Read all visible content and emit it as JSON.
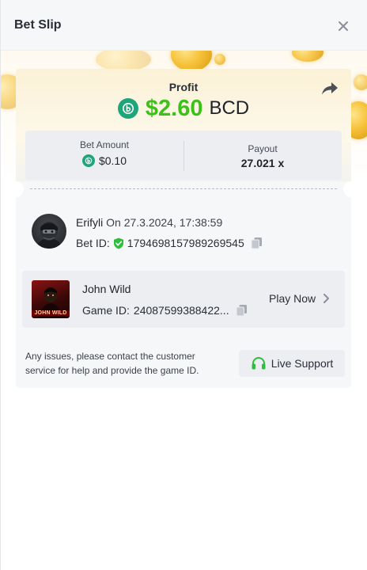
{
  "header": {
    "title": "Bet Slip"
  },
  "profit": {
    "label": "Profit",
    "amount": "$2.60",
    "currency": "BCD"
  },
  "stats": {
    "bet_amount_label": "Bet Amount",
    "bet_amount_value": "$0.10",
    "payout_label": "Payout",
    "payout_value": "27.021 x"
  },
  "user": {
    "name": "Erifyli",
    "played_on": "On 27.3.2024, 17:38:59",
    "bet_id_label": "Bet ID:",
    "bet_id": "1794698157989269545"
  },
  "game": {
    "name": "John Wild",
    "thumb_text": "JOHN WILD",
    "game_id_label": "Game ID:",
    "game_id": "24087599388422...",
    "play_label": "Play Now"
  },
  "footer": {
    "help_text": "Any issues, please contact the customer service for help and provide the game ID.",
    "support_label": "Live Support"
  },
  "colors": {
    "profit_green": "#3bc117",
    "bcd_teal": "#1fa57a",
    "verified_green": "#2ebd3d"
  },
  "icons": {
    "close": "close-icon",
    "share": "share-icon",
    "currency": "bcd-coin-icon",
    "verified": "shield-check-icon",
    "copy": "copy-icon",
    "chevron": "chevron-right-icon",
    "support": "headset-icon"
  }
}
